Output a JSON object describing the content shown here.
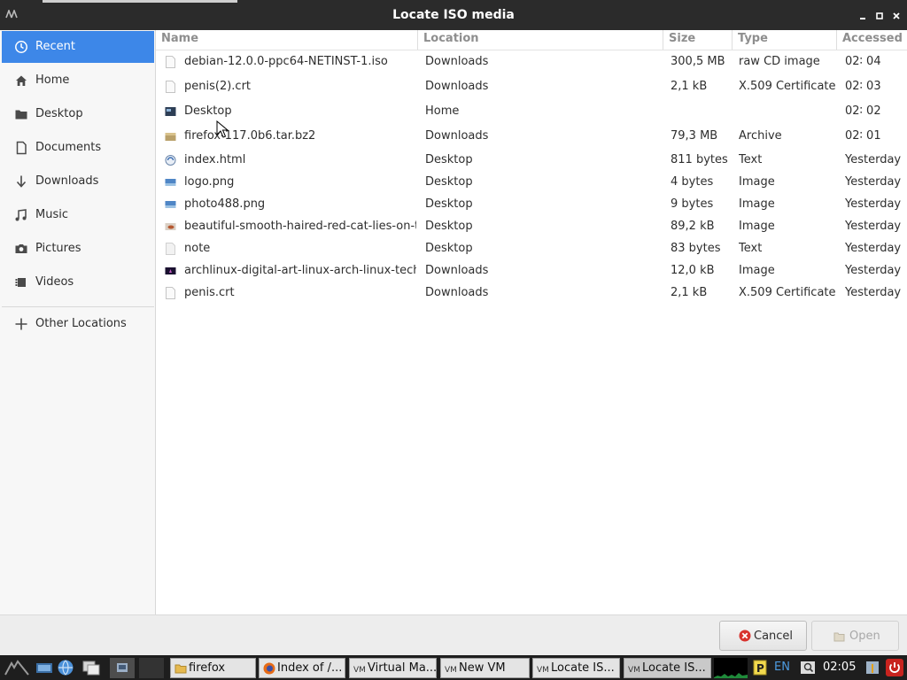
{
  "window": {
    "title": "Locate ISO media"
  },
  "sidebar": {
    "items": [
      {
        "label": "Recent",
        "icon": "clock-icon",
        "active": true
      },
      {
        "label": "Home",
        "icon": "home-icon"
      },
      {
        "label": "Desktop",
        "icon": "folder-icon"
      },
      {
        "label": "Documents",
        "icon": "document-icon"
      },
      {
        "label": "Downloads",
        "icon": "download-arrow-icon"
      },
      {
        "label": "Music",
        "icon": "music-icon"
      },
      {
        "label": "Pictures",
        "icon": "camera-icon"
      },
      {
        "label": "Videos",
        "icon": "film-icon"
      }
    ],
    "other_locations": {
      "label": "Other Locations",
      "icon": "plus-icon"
    }
  },
  "columns": {
    "name": "Name",
    "location": "Location",
    "size": "Size",
    "type": "Type",
    "accessed": "Accessed"
  },
  "files": [
    {
      "name": "debian-12.0.0-ppc64-NETINST-1.iso",
      "location": "Downloads",
      "size": "300,5 MB",
      "type": "raw CD image",
      "accessed": "02∶ 04",
      "icon": "file-icon"
    },
    {
      "name": "penis(2).crt",
      "location": "Downloads",
      "size": "2,1 kB",
      "type": "X.509 Certificate",
      "accessed": "02∶ 03",
      "icon": "file-icon"
    },
    {
      "name": "Desktop",
      "location": "Home",
      "size": "",
      "type": "",
      "accessed": "02∶ 02",
      "icon": "desktop-folder-icon"
    },
    {
      "name": "firefox-117.0b6.tar.bz2",
      "location": "Downloads",
      "size": "79,3 MB",
      "type": "Archive",
      "accessed": "02∶ 01",
      "icon": "archive-icon"
    },
    {
      "name": "index.html",
      "location": "Desktop",
      "size": "811 bytes",
      "type": "Text",
      "accessed": "Yesterday",
      "icon": "html-file-icon"
    },
    {
      "name": "logo.png",
      "location": "Desktop",
      "size": "4 bytes",
      "type": "Image",
      "accessed": "Yesterday",
      "icon": "image-file-icon"
    },
    {
      "name": "photo488.png",
      "location": "Desktop",
      "size": "9 bytes",
      "type": "Image",
      "accessed": "Yesterday",
      "icon": "image-file-icon"
    },
    {
      "name": "beautiful-smooth-haired-red-cat-lies-on-t...",
      "location": "Desktop",
      "size": "89,2 kB",
      "type": "Image",
      "accessed": "Yesterday",
      "icon": "image-thumbnail-icon"
    },
    {
      "name": "note",
      "location": "Desktop",
      "size": "83 bytes",
      "type": "Text",
      "accessed": "Yesterday",
      "icon": "file-icon"
    },
    {
      "name": "archlinux-digital-art-linux-arch-linux-tech-...",
      "location": "Downloads",
      "size": "12,0 kB",
      "type": "Image",
      "accessed": "Yesterday",
      "icon": "image-thumbnail-icon"
    },
    {
      "name": "penis.crt",
      "location": "Downloads",
      "size": "2,1 kB",
      "type": "X.509 Certificate",
      "accessed": "Yesterday",
      "icon": "file-icon"
    }
  ],
  "buttons": {
    "cancel": "Cancel",
    "open": "Open"
  },
  "taskbar": {
    "tasks": [
      {
        "label": "firefox",
        "icon": "folder-icon"
      },
      {
        "label": "Index of /...",
        "icon": "firefox-icon"
      },
      {
        "label": "Virtual Ma...",
        "icon": "virtualbox-icon"
      },
      {
        "label": "New VM",
        "icon": "virtualbox-icon"
      },
      {
        "label": "Locate IS...",
        "icon": "virtualbox-icon"
      },
      {
        "label": "Locate IS...",
        "icon": "virtualbox-icon",
        "active": true
      }
    ],
    "lang": "EN",
    "clock": "02:05"
  },
  "colors": {
    "accent": "#3d87e8",
    "titlebar": "#2b2b2b",
    "taskbar": "#1e1e1e"
  }
}
